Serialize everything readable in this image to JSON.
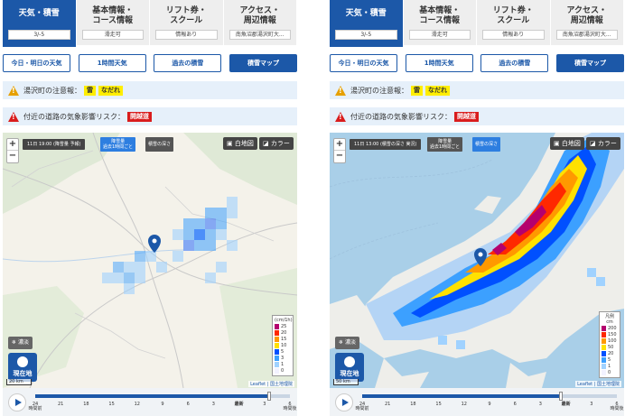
{
  "panels": [
    {
      "id": "left",
      "category_tabs": [
        {
          "label": "天気・積雪",
          "sub": "3/-5"
        },
        {
          "label": "基本情報・\nコース情報",
          "sub": "滑走可"
        },
        {
          "label": "リフト券・\nスクール",
          "sub": "情報あり"
        },
        {
          "label": "アクセス・\n周辺情報",
          "sub": "南魚沼郡湯沢町大..."
        }
      ],
      "sub_tabs": [
        "今日・明日の天気",
        "1時間天気",
        "過去の積雪",
        "積雪マップ"
      ],
      "alert1": {
        "label": "湯沢町の注意報：",
        "tags": [
          "雷",
          "なだれ"
        ]
      },
      "alert2": {
        "label": "付近の道路の気象影響リスク：",
        "tags": [
          "開越道"
        ]
      },
      "map": {
        "time_label": "11日 19:00 (降雪量 予報)",
        "btn1": "降雪量\n過去1時間ごと",
        "btn2": "積雪の深さ",
        "white_map": "白地図",
        "color_map": "カラー",
        "legend_title": "(cm/1h)",
        "legend": [
          {
            "v": "25",
            "c": "#b4006e"
          },
          {
            "v": "20",
            "c": "#ff2800"
          },
          {
            "v": "15",
            "c": "#ff9900"
          },
          {
            "v": "10",
            "c": "#ffe100"
          },
          {
            "v": "5",
            "c": "#0050ff"
          },
          {
            "v": "3",
            "c": "#3ca0ff"
          },
          {
            "v": "1",
            "c": "#a0d2ff"
          },
          {
            "v": "0",
            "c": "#f2f2ff"
          }
        ],
        "snow_btn": "濃淡",
        "loc_btn": "現在地",
        "scale": "20 km",
        "attrib": "Leaflet | 国土地理院"
      },
      "timeline": {
        "ticks": [
          {
            "t": "24\n時間前"
          },
          {
            "t": "21"
          },
          {
            "t": "18"
          },
          {
            "t": "15"
          },
          {
            "t": "12"
          },
          {
            "t": "9"
          },
          {
            "t": "6"
          },
          {
            "t": "3"
          },
          {
            "t": "最新",
            "bold": true
          },
          {
            "t": "3"
          },
          {
            "t": "6\n時間後"
          }
        ],
        "progress": 0.92
      }
    },
    {
      "id": "right",
      "category_tabs": [
        {
          "label": "天気・積雪",
          "sub": "3/-5"
        },
        {
          "label": "基本情報・\nコース情報",
          "sub": "滑走可"
        },
        {
          "label": "リフト券・\nスクール",
          "sub": "情報あり"
        },
        {
          "label": "アクセス・\n周辺情報",
          "sub": "南魚沼郡湯沢町大..."
        }
      ],
      "sub_tabs": [
        "今日・明日の天気",
        "1時間天気",
        "過去の積雪",
        "積雪マップ"
      ],
      "alert1": {
        "label": "湯沢町の注意報：",
        "tags": [
          "雷",
          "なだれ"
        ]
      },
      "alert2": {
        "label": "付近の道路の気象影響リスク：",
        "tags": [
          "開越道"
        ]
      },
      "map": {
        "time_label": "11日 13:00 (積雪の深さ 実況)",
        "btn1": "降雪量\n過去1時間ごと",
        "btn2": "積雪の深さ",
        "white_map": "白地図",
        "color_map": "カラー",
        "legend_title": "凡例\ncm",
        "legend": [
          {
            "v": "200",
            "c": "#b4006e"
          },
          {
            "v": "150",
            "c": "#ff2800"
          },
          {
            "v": "100",
            "c": "#ff9900"
          },
          {
            "v": "50",
            "c": "#ffe100"
          },
          {
            "v": "20",
            "c": "#0050ff"
          },
          {
            "v": "5",
            "c": "#3ca0ff"
          },
          {
            "v": "1",
            "c": "#a0d2ff"
          },
          {
            "v": "0",
            "c": "#f2f2ff"
          }
        ],
        "snow_btn": "濃淡",
        "loc_btn": "現在地",
        "scale": "50 km",
        "attrib": "Leaflet | 国土地理院"
      },
      "timeline": {
        "ticks": [
          {
            "t": "24\n時間前"
          },
          {
            "t": "21"
          },
          {
            "t": "18"
          },
          {
            "t": "15"
          },
          {
            "t": "12"
          },
          {
            "t": "9"
          },
          {
            "t": "6"
          },
          {
            "t": "3"
          },
          {
            "t": "最新",
            "bold": true
          },
          {
            "t": "3"
          },
          {
            "t": "6\n時間後"
          }
        ],
        "progress": 0.78
      }
    }
  ]
}
